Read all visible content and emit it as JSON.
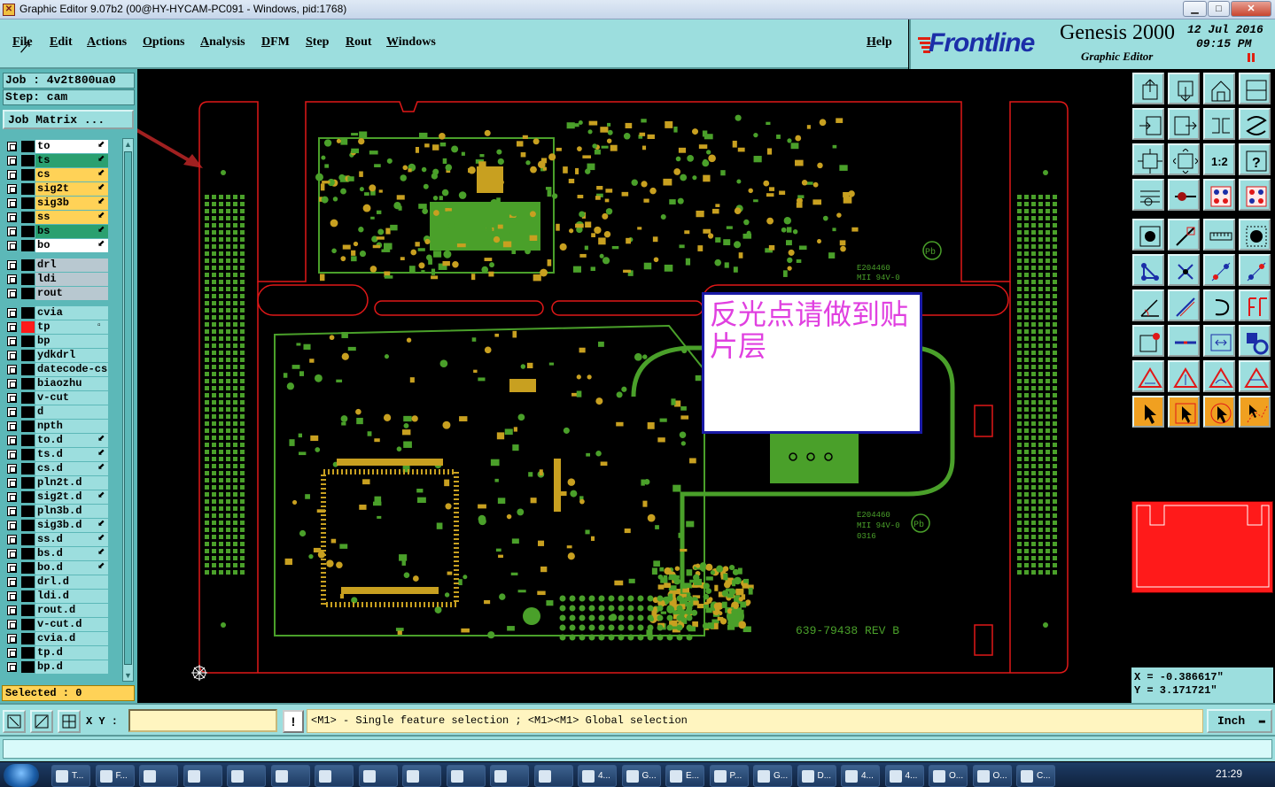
{
  "window": {
    "title": "Graphic Editor 9.07b2 (00@HY-HYCAM-PC091 - Windows, pid:1768)",
    "controls": {
      "minimize": "▁",
      "maximize": "□",
      "close": "✕"
    }
  },
  "menu": {
    "items": [
      "File",
      "Edit",
      "Actions",
      "Options",
      "Analysis",
      "DFM",
      "Step",
      "Rout",
      "Windows"
    ],
    "help": "Help"
  },
  "logo": {
    "brand": "Frontline",
    "product": "Genesis 2000",
    "subtitle": "Graphic Editor",
    "date": "12 Jul 2016",
    "time": "09:15 PM",
    "colors": {
      "brand": "#1b2ea8",
      "accent": "#e02010"
    }
  },
  "left_panel": {
    "job": "Job : 4v2t800ua0",
    "step": "Step: cam",
    "job_matrix_button": "Job Matrix ...",
    "layers": [
      {
        "name": "to",
        "color": "#ffffff",
        "flag": "⬋"
      },
      {
        "name": "ts",
        "color": "#2aa070",
        "flag": "⬋"
      },
      {
        "name": "cs",
        "color": "#ffd257",
        "flag": "⬋"
      },
      {
        "name": "sig2t",
        "color": "#ffd257",
        "flag": "⬋"
      },
      {
        "name": "sig3b",
        "color": "#ffd257",
        "flag": "⬋"
      },
      {
        "name": "ss",
        "color": "#ffd257",
        "flag": "⬋"
      },
      {
        "name": "bs",
        "color": "#2aa070",
        "flag": "⬋"
      },
      {
        "name": "bo",
        "color": "#ffffff",
        "flag": "⬋"
      },
      {
        "name": "drl",
        "color": "#b8c8d0",
        "flag": ""
      },
      {
        "name": "ldi",
        "color": "#b8c8d0",
        "flag": ""
      },
      {
        "name": "rout",
        "color": "#b8c8d0",
        "flag": ""
      },
      {
        "name": "cvia",
        "color": "#9cdede",
        "flag": ""
      },
      {
        "name": "tp",
        "color": "#9cdede",
        "flag": "▫"
      },
      {
        "name": "bp",
        "color": "#9cdede",
        "flag": ""
      },
      {
        "name": "ydkdrl",
        "color": "#9cdede",
        "flag": ""
      },
      {
        "name": "datecode-cs",
        "color": "#9cdede",
        "flag": ""
      },
      {
        "name": "biaozhu",
        "color": "#9cdede",
        "flag": ""
      },
      {
        "name": "v-cut",
        "color": "#9cdede",
        "flag": ""
      },
      {
        "name": "d",
        "color": "#9cdede",
        "flag": ""
      },
      {
        "name": "npth",
        "color": "#9cdede",
        "flag": ""
      },
      {
        "name": "to.d",
        "color": "#9cdede",
        "flag": "⬋"
      },
      {
        "name": "ts.d",
        "color": "#9cdede",
        "flag": "⬋"
      },
      {
        "name": "cs.d",
        "color": "#9cdede",
        "flag": "⬋"
      },
      {
        "name": "pln2t.d",
        "color": "#9cdede",
        "flag": ""
      },
      {
        "name": "sig2t.d",
        "color": "#9cdede",
        "flag": "⬋"
      },
      {
        "name": "pln3b.d",
        "color": "#9cdede",
        "flag": ""
      },
      {
        "name": "sig3b.d",
        "color": "#9cdede",
        "flag": "⬋"
      },
      {
        "name": "ss.d",
        "color": "#9cdede",
        "flag": "⬋"
      },
      {
        "name": "bs.d",
        "color": "#9cdede",
        "flag": "⬋"
      },
      {
        "name": "bo.d",
        "color": "#9cdede",
        "flag": "⬋"
      },
      {
        "name": "drl.d",
        "color": "#9cdede",
        "flag": ""
      },
      {
        "name": "ldi.d",
        "color": "#9cdede",
        "flag": ""
      },
      {
        "name": "rout.d",
        "color": "#9cdede",
        "flag": ""
      },
      {
        "name": "v-cut.d",
        "color": "#9cdede",
        "flag": ""
      },
      {
        "name": "cvia.d",
        "color": "#9cdede",
        "flag": ""
      },
      {
        "name": "tp.d",
        "color": "#9cdede",
        "flag": ""
      },
      {
        "name": "bp.d",
        "color": "#9cdede",
        "flag": ""
      }
    ],
    "work_layer": "tp",
    "work_layer_color": "#ff1a1a",
    "selected": "Selected : 0"
  },
  "canvas": {
    "note": "反光点请做到贴片层",
    "board_label": "639-79438 REV B",
    "ul_mark_1": "E204460",
    "ul_mark_2": "MII 94V-0",
    "ul_mark_3": "0316",
    "pb_mark": "Pb",
    "colors": {
      "outline": "#e01818",
      "copper": "#4aa02a",
      "pad": "#c8a020",
      "background": "#000000"
    }
  },
  "toolbox": {
    "tools": [
      "move-up-icon",
      "move-down-icon",
      "home-icon",
      "split-window-icon",
      "zoom-in-box-icon",
      "zoom-out-box-icon",
      "mirror-icon",
      "redraw-icon",
      "fit-width-icon",
      "fit-all-icon",
      "ratio-icon",
      "help-icon",
      "measure-icon",
      "snap-icon",
      "layer-colors-icon",
      "layer-colors-alt-icon",
      "pad-icon",
      "line-icon",
      "ruler-icon",
      "circle-pad-icon",
      "node-icon",
      "cross-icon",
      "arc-point-icon",
      "arc-point-alt-icon",
      "angle-icon",
      "slash-icon",
      "arc-icon",
      "text-icon",
      "point-select-icon",
      "h-line-icon",
      "zoom-fit-icon",
      "group-icon",
      "triangle-icon",
      "triangle-up-icon",
      "triangle-arc-icon",
      "triangle-alt-icon",
      "pointer-icon",
      "pointer-box-icon",
      "pointer-circle-icon",
      "pointer-route-icon"
    ],
    "ratio_label": "1:2",
    "help_label": "?",
    "coord_x": "X = -0.386617\"",
    "coord_y": "Y = 3.171721\""
  },
  "bottom": {
    "xy_label": "X Y :",
    "xy_value": "",
    "message_icon": "!",
    "message": "<M1> - Single feature selection ; <M1><M1> Global selection",
    "unit": "Inch",
    "status": ""
  },
  "taskbar": {
    "tasks": [
      "T...",
      "F...",
      "",
      "",
      "",
      "",
      "",
      "",
      "",
      "",
      "",
      "",
      "4...",
      "G...",
      "E...",
      "P...",
      "G...",
      "D...",
      "4...",
      "4...",
      "O...",
      "O...",
      "C..."
    ],
    "clock": "21:29"
  }
}
